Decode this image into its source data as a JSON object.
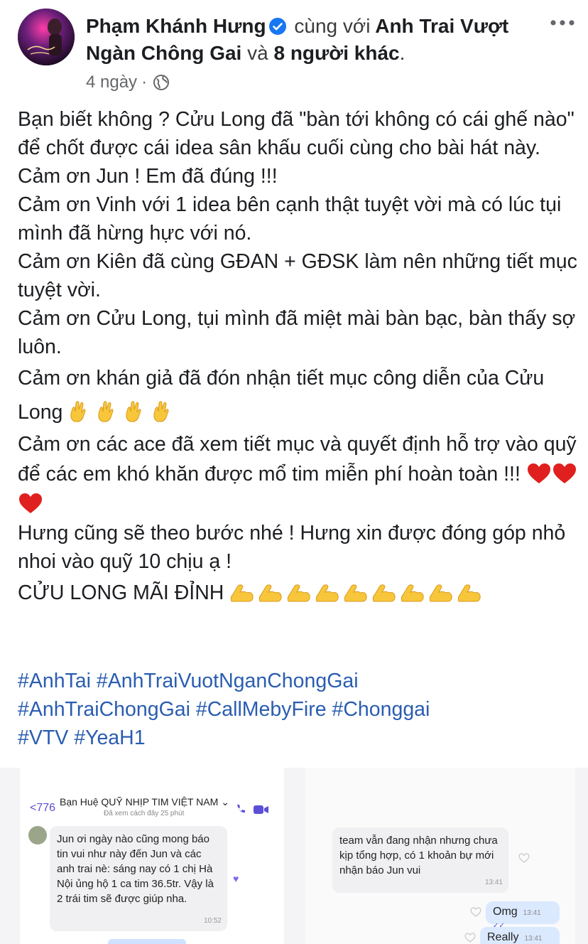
{
  "post": {
    "author": "Phạm Khánh Hưng",
    "with_word": "cùng với",
    "tagged_page": "Anh Trai Vượt Ngàn Chông Gai",
    "and_word": "và",
    "others": "8 người khác",
    "period": ".",
    "time": "4 ngày",
    "dot": "·",
    "privacy_icon": "globe-icon",
    "verified_color": "#1877f2"
  },
  "body": {
    "p1": "Bạn biết không ? Cửu Long đã \"bàn tới không có cái ghế nào\" để chốt được cái idea sân khấu cuối cùng cho bài hát này.",
    "p2": "Cảm ơn Jun ! Em đã đúng !!!",
    "p3": "Cảm ơn Vinh với 1 idea bên cạnh thật tuyệt vời mà có lúc tụi mình đã hừng hực với nó.",
    "p4": "Cảm ơn Kiên đã cùng GĐAN + GĐSK làm nên những tiết mục tuyệt vời.",
    "p5": "Cảm ơn Cửu Long, tụi mình đã miệt mài bàn bạc, bàn thấy sợ luôn.",
    "p6": "Cảm ơn khán giả đã đón nhận tiết mục công diễn của Cửu Long",
    "p7": "Cảm ơn các ace đã xem tiết mục và quyết định hỗ trợ vào quỹ để các em khó khăn được mổ tim miễn phí hoàn toàn !!!",
    "p8": "Hưng cũng sẽ theo bước nhé ! Hưng xin được đóng góp nhỏ nhoi vào quỹ 10 chịu ạ !",
    "p9": "CỬU LONG MÃI ĐỈNH"
  },
  "hashtags": {
    "t1": "#AnhTai",
    "t2": "#AnhTraiVuotNganChongGai",
    "t3": "#AnhTraiChongGai",
    "t4": "#CallMebyFire",
    "t5": "#Chonggai",
    "t6": "#VTV",
    "t7": "#YeaH1"
  },
  "screenshot": {
    "back_label": "776",
    "contact_name": "Bạn Huệ QUỸ NHỊP TIM VIỆT NAM",
    "chevron": "⌄",
    "last_seen": "Đã xem cách đây 25 phút",
    "msg1": "Jun ơi ngày nào cũng mong báo tin vui như này đến Jun và các anh trai nè: sáng nay có 1 chị Hà Nội ủng hộ 1 ca tim 36.5tr. Vậy là 2 trái tim sẽ được giúp nha.",
    "msg1_time": "10:52",
    "msg2": "team vẫn đang nhận nhưng chưa kịp tổng hợp, có 1 khoản bự mới nhận báo Jun vui",
    "msg2_time": "13:41",
    "reply1": "Omg",
    "reply1_time": "13:41",
    "reply2": "Really",
    "reply2_time": "13:41",
    "accent": "#5b4fd8"
  }
}
